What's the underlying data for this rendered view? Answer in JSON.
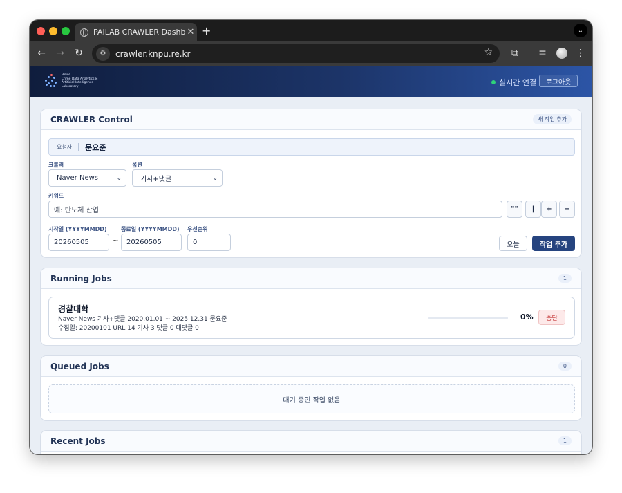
{
  "browser": {
    "tab_title": "PAILAB CRAWLER Dashboard",
    "tab_close": "✕",
    "new_tab": "+",
    "url": "crawler.knpu.re.kr"
  },
  "header": {
    "logo_lines": [
      "Police",
      "Crime Data Analytics &",
      "Artificial Intelligence",
      "Laboratory"
    ],
    "live_status": "실시간 연결",
    "live_color": "#2fd27a",
    "logout_label": "로그아웃"
  },
  "control": {
    "title": "CRAWLER Control",
    "new_task_label": "새 작업 추가",
    "requester_label": "요청자",
    "requester_name": "문요준",
    "crawler_label": "크롤러",
    "crawler_value": "Naver News",
    "option_label": "옵션",
    "option_value": "기사+댓글",
    "keyword_label": "키워드",
    "keyword_placeholder": "예: 반도체 산업",
    "operators": [
      "\"\"",
      "|",
      "+",
      "−"
    ],
    "start_label": "시작일 (YYYYMMDD)",
    "start_value": "20260505",
    "range_sep": "~",
    "end_label": "종료일 (YYYYMMDD)",
    "end_value": "20260505",
    "priority_label": "우선순위",
    "priority_value": "0",
    "today_label": "오늘",
    "add_label": "작업 추가"
  },
  "running": {
    "title": "Running Jobs",
    "count": "1",
    "job": {
      "name": "경찰대학",
      "meta": "Naver News   기사+댓글   2020.01.01 ~ 2025.12.31   문요준",
      "stats": "수집일: 20200101   URL 14   기사 3   댓글 0   대댓글 0",
      "progress": 0,
      "progress_label": "0%",
      "stop_label": "중단"
    }
  },
  "queued": {
    "title": "Queued Jobs",
    "count": "0",
    "empty_text": "대기 중인 작업 없음"
  },
  "recent": {
    "title": "Recent Jobs",
    "count": "1"
  },
  "colors": {
    "accent": "#26447f",
    "danger": "#c63b3b"
  }
}
